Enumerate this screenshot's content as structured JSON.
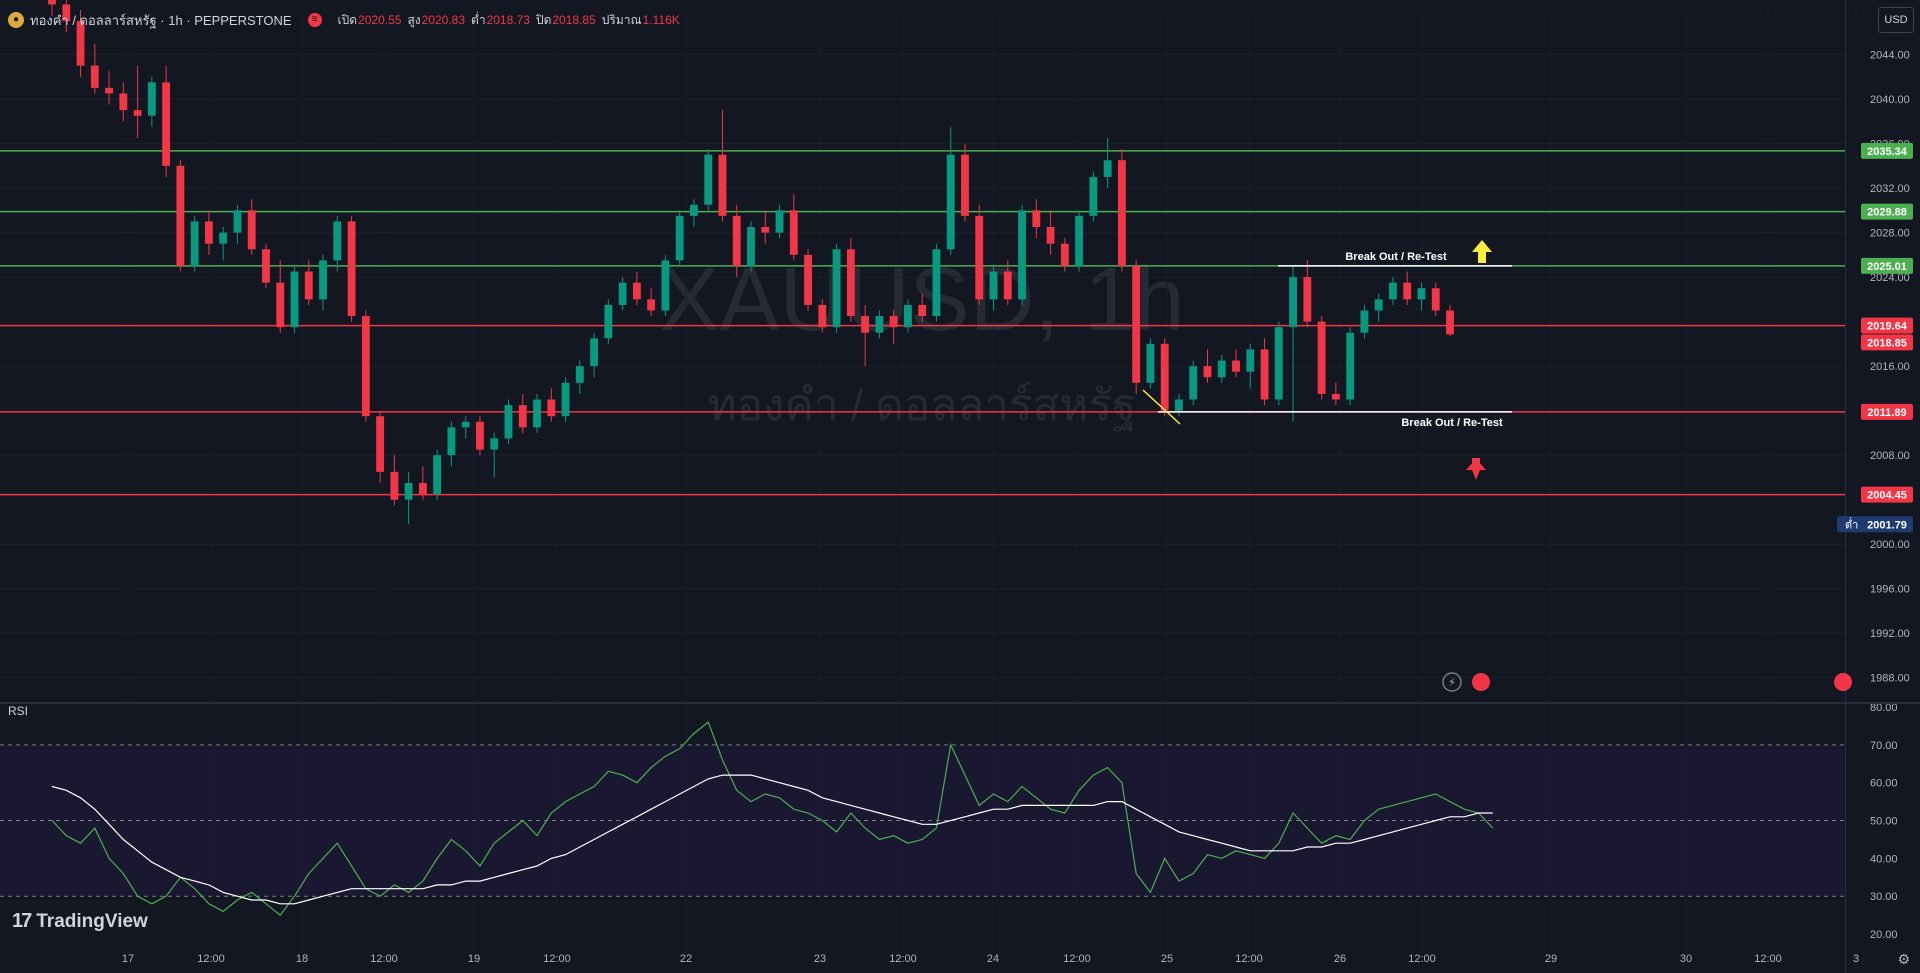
{
  "header": {
    "symbol_title": "ทองคำ / ดอลลาร์สหรัฐ · 1h · PEPPERSTONE",
    "ohlc": [
      {
        "label": "เปิด",
        "value": "2020.55"
      },
      {
        "label": "สูง",
        "value": "2020.83"
      },
      {
        "label": "ต่ำ",
        "value": "2018.73"
      },
      {
        "label": "ปิด",
        "value": "2018.85"
      },
      {
        "label": "ปริมาณ",
        "value": "1.116K"
      }
    ],
    "currency": "USD"
  },
  "colors": {
    "background": "#131722",
    "up": "#089981",
    "down": "#f23645",
    "resistance_line": "#4caf50",
    "support_line": "#f23645",
    "rsi_line": "#4caf50",
    "rsi_ma": "#ffffff",
    "watermark": "#2a2e39"
  },
  "watermark": {
    "symbol": "XAUUSD, 1h",
    "name": "ทองคำ / ดอลลาร์สหรัฐ"
  },
  "branding": {
    "logo_text": "TradingView"
  },
  "rsi_pane": {
    "label": "RSI"
  },
  "chart_data": [
    {
      "type": "candlestick",
      "timeframe": "1h",
      "ylim": [
        1986.0,
        2048.0
      ],
      "y_ticks": [
        "2044.00",
        "2040.00",
        "2036.00",
        "2032.00",
        "2028.00",
        "2024.00",
        "2016.00",
        "2008.00",
        "2000.00",
        "1996.00",
        "1992.00",
        "1988.00"
      ],
      "x_ticks": [
        "17",
        "12:00",
        "18",
        "12:00",
        "19",
        "12:00",
        "22",
        "23",
        "12:00",
        "24",
        "12:00",
        "25",
        "12:00",
        "26",
        "12:00",
        "29",
        "30",
        "12:00",
        "3"
      ],
      "levels": [
        {
          "value": 2035.34,
          "label": "2035.34",
          "kind": "resistance"
        },
        {
          "value": 2029.88,
          "label": "2029.88",
          "kind": "resistance"
        },
        {
          "value": 2025.01,
          "label": "2025.01",
          "kind": "resistance"
        },
        {
          "value": 2019.64,
          "label": "2019.64",
          "kind": "support"
        },
        {
          "value": 2011.89,
          "label": "2011.89",
          "kind": "support"
        },
        {
          "value": 2004.45,
          "label": "2004.45",
          "kind": "support"
        }
      ],
      "last_price": {
        "value": 2018.85,
        "label": "2018.85"
      },
      "low_marker": {
        "value": 2001.79,
        "label": "2001.79",
        "prefix": "ต่ำ"
      },
      "annotations": [
        {
          "text": "Break Out / Re-Test",
          "price": 2025.01,
          "arrow": "up"
        },
        {
          "text": "Break Out / Re-Test",
          "price": 2011.89,
          "arrow": "down"
        }
      ],
      "candles": [
        [
          2049.0,
          2050.0,
          2047.5,
          2048.5
        ],
        [
          2048.5,
          2049.5,
          2046.0,
          2047.0
        ],
        [
          2047.0,
          2048.0,
          2042.0,
          2043.0
        ],
        [
          2043.0,
          2045.0,
          2040.5,
          2041.0
        ],
        [
          2041.0,
          2042.5,
          2039.5,
          2040.5
        ],
        [
          2040.5,
          2041.5,
          2038.0,
          2039.0
        ],
        [
          2039.0,
          2043.0,
          2036.5,
          2038.5
        ],
        [
          2038.5,
          2042.0,
          2037.5,
          2041.5
        ],
        [
          2041.5,
          2043.0,
          2033.0,
          2034.0
        ],
        [
          2034.0,
          2034.5,
          2024.5,
          2025.0
        ],
        [
          2025.0,
          2029.5,
          2024.5,
          2029.0
        ],
        [
          2029.0,
          2030.0,
          2026.0,
          2027.0
        ],
        [
          2027.0,
          2028.5,
          2025.5,
          2028.0
        ],
        [
          2028.0,
          2030.5,
          2027.0,
          2030.0
        ],
        [
          2030.0,
          2031.0,
          2026.0,
          2026.5
        ],
        [
          2026.5,
          2027.0,
          2023.0,
          2023.5
        ],
        [
          2023.5,
          2025.5,
          2019.0,
          2019.5
        ],
        [
          2019.5,
          2025.0,
          2019.0,
          2024.5
        ],
        [
          2024.5,
          2025.5,
          2021.5,
          2022.0
        ],
        [
          2022.0,
          2026.0,
          2021.0,
          2025.5
        ],
        [
          2025.5,
          2029.5,
          2024.5,
          2029.0
        ],
        [
          2029.0,
          2029.5,
          2020.0,
          2020.5
        ],
        [
          2020.5,
          2021.0,
          2011.0,
          2011.5
        ],
        [
          2011.5,
          2012.0,
          2005.5,
          2006.5
        ],
        [
          2006.5,
          2008.0,
          2003.5,
          2004.0
        ],
        [
          2004.0,
          2006.5,
          2001.8,
          2005.5
        ],
        [
          2005.5,
          2007.0,
          2004.0,
          2004.5
        ],
        [
          2004.5,
          2008.5,
          2004.0,
          2008.0
        ],
        [
          2008.0,
          2011.0,
          2007.0,
          2010.5
        ],
        [
          2010.5,
          2011.5,
          2009.5,
          2011.0
        ],
        [
          2011.0,
          2011.5,
          2008.0,
          2008.5
        ],
        [
          2008.5,
          2010.0,
          2006.0,
          2009.5
        ],
        [
          2009.5,
          2013.0,
          2009.0,
          2012.5
        ],
        [
          2012.5,
          2013.5,
          2010.0,
          2010.5
        ],
        [
          2010.5,
          2013.5,
          2010.0,
          2013.0
        ],
        [
          2013.0,
          2014.0,
          2011.0,
          2011.5
        ],
        [
          2011.5,
          2015.0,
          2011.0,
          2014.5
        ],
        [
          2014.5,
          2016.5,
          2013.5,
          2016.0
        ],
        [
          2016.0,
          2019.0,
          2015.0,
          2018.5
        ],
        [
          2018.5,
          2022.0,
          2018.0,
          2021.5
        ],
        [
          2021.5,
          2024.0,
          2021.0,
          2023.5
        ],
        [
          2023.5,
          2024.5,
          2021.5,
          2022.0
        ],
        [
          2022.0,
          2023.0,
          2020.5,
          2021.0
        ],
        [
          2021.0,
          2026.0,
          2020.5,
          2025.5
        ],
        [
          2025.5,
          2030.0,
          2025.0,
          2029.5
        ],
        [
          2029.5,
          2031.0,
          2028.5,
          2030.5
        ],
        [
          2030.5,
          2035.5,
          2030.0,
          2035.0
        ],
        [
          2035.0,
          2039.0,
          2029.0,
          2029.5
        ],
        [
          2029.5,
          2030.5,
          2024.0,
          2025.0
        ],
        [
          2025.0,
          2029.0,
          2024.5,
          2028.5
        ],
        [
          2028.5,
          2030.0,
          2027.0,
          2028.0
        ],
        [
          2028.0,
          2030.5,
          2027.5,
          2030.0
        ],
        [
          2030.0,
          2031.5,
          2025.5,
          2026.0
        ],
        [
          2026.0,
          2026.5,
          2021.0,
          2021.5
        ],
        [
          2021.5,
          2022.0,
          2019.0,
          2019.5
        ],
        [
          2019.5,
          2027.0,
          2019.0,
          2026.5
        ],
        [
          2026.5,
          2027.5,
          2020.0,
          2020.5
        ],
        [
          2020.5,
          2021.5,
          2016.0,
          2019.0
        ],
        [
          2019.0,
          2021.0,
          2018.5,
          2020.5
        ],
        [
          2020.5,
          2021.0,
          2018.0,
          2019.5
        ],
        [
          2019.5,
          2022.0,
          2019.0,
          2021.5
        ],
        [
          2021.5,
          2022.5,
          2020.0,
          2020.5
        ],
        [
          2020.5,
          2027.0,
          2020.0,
          2026.5
        ],
        [
          2026.5,
          2037.5,
          2026.0,
          2035.0
        ],
        [
          2035.0,
          2036.0,
          2029.0,
          2029.5
        ],
        [
          2029.5,
          2030.5,
          2021.5,
          2022.0
        ],
        [
          2022.0,
          2025.0,
          2021.0,
          2024.5
        ],
        [
          2024.5,
          2025.5,
          2021.5,
          2022.0
        ],
        [
          2022.0,
          2030.5,
          2021.5,
          2030.0
        ],
        [
          2030.0,
          2031.0,
          2027.5,
          2028.5
        ],
        [
          2028.5,
          2030.0,
          2026.0,
          2027.0
        ],
        [
          2027.0,
          2027.5,
          2024.5,
          2025.0
        ],
        [
          2025.0,
          2030.0,
          2024.5,
          2029.5
        ],
        [
          2029.5,
          2033.5,
          2029.0,
          2033.0
        ],
        [
          2033.0,
          2036.5,
          2032.0,
          2034.5
        ],
        [
          2034.5,
          2035.5,
          2024.5,
          2025.0
        ],
        [
          2025.0,
          2025.5,
          2013.5,
          2014.5
        ],
        [
          2014.5,
          2018.5,
          2014.0,
          2018.0
        ],
        [
          2018.0,
          2018.5,
          2011.5,
          2012.0
        ],
        [
          2012.0,
          2013.5,
          2011.5,
          2013.0
        ],
        [
          2013.0,
          2016.5,
          2012.5,
          2016.0
        ],
        [
          2016.0,
          2017.5,
          2014.5,
          2015.0
        ],
        [
          2015.0,
          2017.0,
          2014.5,
          2016.5
        ],
        [
          2016.5,
          2017.5,
          2015.0,
          2015.5
        ],
        [
          2015.5,
          2018.0,
          2014.0,
          2017.5
        ],
        [
          2017.5,
          2018.5,
          2012.5,
          2013.0
        ],
        [
          2013.0,
          2020.0,
          2012.5,
          2019.5
        ],
        [
          2019.5,
          2025.0,
          2011.0,
          2024.0
        ],
        [
          2024.0,
          2025.5,
          2019.5,
          2020.0
        ],
        [
          2020.0,
          2020.5,
          2013.0,
          2013.5
        ],
        [
          2013.5,
          2014.5,
          2012.5,
          2013.0
        ],
        [
          2013.0,
          2019.5,
          2012.5,
          2019.0
        ],
        [
          2019.0,
          2021.5,
          2018.5,
          2021.0
        ],
        [
          2021.0,
          2022.5,
          2020.0,
          2022.0
        ],
        [
          2022.0,
          2024.0,
          2021.5,
          2023.5
        ],
        [
          2023.5,
          2024.5,
          2021.5,
          2022.0
        ],
        [
          2022.0,
          2023.5,
          2021.0,
          2023.0
        ],
        [
          2023.0,
          2023.5,
          2020.5,
          2021.0
        ],
        [
          2021.0,
          2021.5,
          2018.7,
          2018.85
        ]
      ]
    },
    {
      "type": "line",
      "name": "RSI",
      "ylim": [
        15.0,
        80.0
      ],
      "y_ticks": [
        "80.00",
        "70.00",
        "60.00",
        "50.00",
        "40.00",
        "30.00",
        "20.00"
      ],
      "bands": [
        70,
        50,
        30
      ],
      "series": [
        {
          "role": "rsi",
          "values": [
            50,
            46,
            44,
            48,
            40,
            36,
            30,
            28,
            30,
            35,
            32,
            28,
            26,
            29,
            31,
            28,
            25,
            30,
            36,
            40,
            44,
            38,
            32,
            30,
            33,
            31,
            34,
            40,
            45,
            42,
            38,
            44,
            47,
            50,
            46,
            52,
            55,
            57,
            59,
            63,
            62,
            60,
            64,
            67,
            69,
            73,
            76,
            66,
            58,
            55,
            57,
            56,
            53,
            52,
            50,
            47,
            52,
            48,
            45,
            46,
            44,
            45,
            48,
            70,
            62,
            54,
            57,
            55,
            59,
            56,
            53,
            52,
            58,
            62,
            64,
            60,
            36,
            31,
            40,
            34,
            36,
            41,
            40,
            42,
            41,
            40,
            44,
            52,
            48,
            44,
            46,
            45,
            50,
            53,
            54,
            55,
            56,
            57,
            55,
            53,
            52,
            48
          ]
        },
        {
          "role": "rsi_ma",
          "values": [
            59,
            58,
            56,
            53,
            49,
            45,
            42,
            39,
            37,
            35,
            34,
            33,
            31,
            30,
            29,
            29,
            28,
            28,
            29,
            30,
            31,
            32,
            32,
            32,
            32,
            32,
            32,
            33,
            33,
            34,
            34,
            35,
            36,
            37,
            38,
            40,
            41,
            43,
            45,
            47,
            49,
            51,
            53,
            55,
            57,
            59,
            61,
            62,
            62,
            62,
            61,
            60,
            59,
            58,
            56,
            55,
            54,
            53,
            52,
            51,
            50,
            49,
            49,
            50,
            51,
            52,
            53,
            53,
            54,
            54,
            54,
            54,
            54,
            54,
            55,
            55,
            53,
            51,
            49,
            47,
            46,
            45,
            44,
            43,
            42,
            42,
            42,
            42,
            43,
            43,
            44,
            44,
            45,
            46,
            47,
            48,
            49,
            50,
            51,
            51,
            52,
            52
          ]
        }
      ]
    }
  ]
}
